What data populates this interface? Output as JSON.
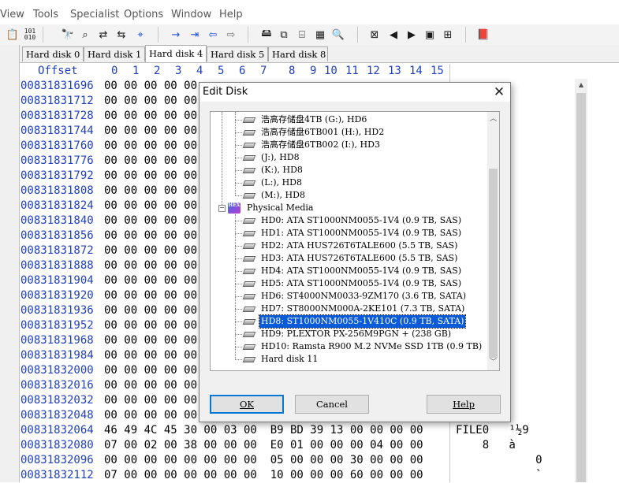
{
  "menubar": {
    "items": [
      "View",
      "Tools",
      "Specialist",
      "Options",
      "Window",
      "Help"
    ]
  },
  "toolbar": {
    "icons": [
      "paste-icon",
      "binary-icon",
      "find-icon",
      "find-hex-icon",
      "replace-icon",
      "replace-hex-icon",
      "find-again-icon",
      "goto-offset-icon",
      "goto-bookmark-icon",
      "back-icon",
      "forward-icon",
      "disk-icon",
      "copy-disk-icon",
      "tape-icon",
      "calculator-icon",
      "search-icon",
      "clear-icon",
      "prev-icon",
      "next-icon",
      "camera-icon",
      "grid-icon",
      "book-icon"
    ]
  },
  "tabs": [
    "Hard disk 0",
    "Hard disk 1",
    "Hard disk 4",
    "Hard disk 5",
    "Hard disk 8"
  ],
  "active_tab": 2,
  "hex": {
    "offset_label": "Offset",
    "columns": [
      "0",
      "1",
      "2",
      "3",
      "4",
      "5",
      "6",
      "7",
      "8",
      "9",
      "10",
      "11",
      "12",
      "13",
      "14",
      "15"
    ],
    "rows": [
      {
        "offset": "00831831696",
        "bytes": "00 00 00 00 00",
        "ascii": ""
      },
      {
        "offset": "00831831712",
        "bytes": "00 00 00 00 00",
        "ascii": ""
      },
      {
        "offset": "00831831728",
        "bytes": "00 00 00 00 00",
        "ascii": ""
      },
      {
        "offset": "00831831744",
        "bytes": "00 00 00 00 00",
        "ascii": ""
      },
      {
        "offset": "00831831760",
        "bytes": "00 00 00 00 00",
        "ascii": ""
      },
      {
        "offset": "00831831776",
        "bytes": "00 00 00 00 00",
        "ascii": ""
      },
      {
        "offset": "00831831792",
        "bytes": "00 00 00 00 00",
        "ascii": ""
      },
      {
        "offset": "00831831808",
        "bytes": "00 00 00 00 00",
        "ascii": ""
      },
      {
        "offset": "00831831824",
        "bytes": "00 00 00 00 00",
        "ascii": ""
      },
      {
        "offset": "00831831840",
        "bytes": "00 00 00 00 00",
        "ascii": ""
      },
      {
        "offset": "00831831856",
        "bytes": "00 00 00 00 00",
        "ascii": ""
      },
      {
        "offset": "00831831872",
        "bytes": "00 00 00 00 00",
        "ascii": ""
      },
      {
        "offset": "00831831888",
        "bytes": "00 00 00 00 00",
        "ascii": ""
      },
      {
        "offset": "00831831904",
        "bytes": "00 00 00 00 00",
        "ascii": ""
      },
      {
        "offset": "00831831920",
        "bytes": "00 00 00 00 00",
        "ascii": ""
      },
      {
        "offset": "00831831936",
        "bytes": "00 00 00 00 00",
        "ascii": ""
      },
      {
        "offset": "00831831952",
        "bytes": "00 00 00 00 00",
        "ascii": ""
      },
      {
        "offset": "00831831968",
        "bytes": "00 00 00 00 00",
        "ascii": ""
      },
      {
        "offset": "00831831984",
        "bytes": "00 00 00 00 00",
        "ascii": ""
      },
      {
        "offset": "00831832000",
        "bytes": "00 00 00 00 00",
        "ascii": ""
      },
      {
        "offset": "00831832016",
        "bytes": "00 00 00 00 00",
        "ascii": ""
      },
      {
        "offset": "00831832032",
        "bytes": "00 00 00 00 00",
        "ascii": ""
      },
      {
        "offset": "00831832048",
        "bytes": "00 00 00 00 00",
        "ascii": ""
      },
      {
        "offset": "00831832064",
        "bytes": "46 49 4C 45 30 00 03 00  B9 BD 39 13 00 00 00 00",
        "ascii": "FILE0   ¹½9"
      },
      {
        "offset": "00831832080",
        "bytes": "07 00 02 00 38 00 00 00  E0 01 00 00 00 04 00 00",
        "ascii": "    8   à"
      },
      {
        "offset": "00831832096",
        "bytes": "00 00 00 00 00 00 00 00  05 00 00 00 30 00 00 00",
        "ascii": "            0"
      },
      {
        "offset": "00831832112",
        "bytes": "07 00 00 00 00 00 00 00  10 00 00 00 60 00 00 00",
        "ascii": "            `"
      }
    ]
  },
  "dialog": {
    "title": "Edit Disk",
    "tree": [
      {
        "label": "浩高存储盘4TB (G:), HD6",
        "level": 1,
        "icon": "drive-icon",
        "selected": false
      },
      {
        "label": "浩高存储盘6TB001 (H:), HD2",
        "level": 1,
        "icon": "drive-icon",
        "selected": false
      },
      {
        "label": "浩高存储盘6TB002 (I:), HD3",
        "level": 1,
        "icon": "drive-icon",
        "selected": false
      },
      {
        "label": "(J:), HD8",
        "level": 1,
        "icon": "drive-icon",
        "selected": false
      },
      {
        "label": "(K:), HD8",
        "level": 1,
        "icon": "drive-icon",
        "selected": false
      },
      {
        "label": "(L:), HD8",
        "level": 1,
        "icon": "drive-icon",
        "selected": false
      },
      {
        "label": "(M:), HD8",
        "level": 1,
        "icon": "drive-icon",
        "selected": false
      },
      {
        "label": "Physical Media",
        "level": 0,
        "icon": "physical-media-icon",
        "selected": false
      },
      {
        "label": "HD0: ATA     ST1000NM0055-1V4 (0.9 TB, SAS)",
        "level": 1,
        "icon": "drive-icon",
        "selected": false
      },
      {
        "label": "HD1: ATA     ST1000NM0055-1V4 (0.9 TB, SAS)",
        "level": 1,
        "icon": "drive-icon",
        "selected": false
      },
      {
        "label": "HD2: ATA     HUS726T6TALE600 (5.5 TB, SAS)",
        "level": 1,
        "icon": "drive-icon",
        "selected": false
      },
      {
        "label": "HD3: ATA     HUS726T6TALE600 (5.5 TB, SAS)",
        "level": 1,
        "icon": "drive-icon",
        "selected": false
      },
      {
        "label": "HD4: ATA     ST1000NM0055-1V4 (0.9 TB, SAS)",
        "level": 1,
        "icon": "drive-icon",
        "selected": false
      },
      {
        "label": "HD5: ATA     ST1000NM0055-1V4 (0.9 TB, SAS)",
        "level": 1,
        "icon": "drive-icon",
        "selected": false
      },
      {
        "label": "HD6: ST4000NM0033-9ZM170 (3.6 TB, SATA)",
        "level": 1,
        "icon": "drive-icon",
        "selected": false
      },
      {
        "label": "HD7: ST8000NM000A-2KE101 (7.3 TB, SATA)",
        "level": 1,
        "icon": "drive-icon",
        "selected": false
      },
      {
        "label": "HD8: ST1000NM0055-1V410C (0.9 TB, SATA)",
        "level": 1,
        "icon": "drive-icon",
        "selected": true
      },
      {
        "label": "HD9: PLEXTOR PX-256M9PGN + (238 GB)",
        "level": 1,
        "icon": "drive-icon",
        "selected": false
      },
      {
        "label": "HD10: Ramsta R900 M.2 NVMe SSD 1TB (0.9 TB)",
        "level": 1,
        "icon": "drive-icon",
        "selected": false
      },
      {
        "label": "Hard disk 11",
        "level": 1,
        "icon": "drive-icon",
        "selected": false
      }
    ],
    "buttons": {
      "ok": "OK",
      "cancel": "Cancel",
      "help": "Help"
    }
  },
  "colors": {
    "offset_blue": "#1f3fbf",
    "selection": "#0a5bd8",
    "dialog_bg": "#f0f0f0"
  }
}
